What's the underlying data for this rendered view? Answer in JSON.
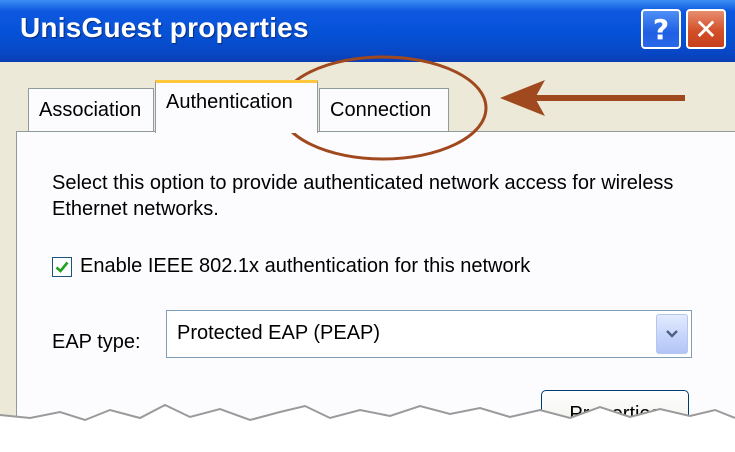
{
  "window": {
    "title": "UnisGuest properties",
    "help_label": "?",
    "close_label": "✕"
  },
  "tabs": [
    {
      "label": "Association"
    },
    {
      "label": "Authentication",
      "selected": true
    },
    {
      "label": "Connection"
    }
  ],
  "panel": {
    "description": "Select this option to provide authenticated network access for wireless Ethernet networks.",
    "enable_checkbox": {
      "label": "Enable IEEE 802.1x authentication for this network",
      "checked": true
    },
    "eap_type": {
      "label": "EAP type:",
      "value": "Protected EAP (PEAP)"
    },
    "properties_button": "Properties"
  },
  "colors": {
    "titlebar": "#0552d6",
    "tab_highlight": "#ffc73c",
    "annotation": "#a0481e",
    "checkmark": "#21a121"
  },
  "icons": [
    "help-icon",
    "close-icon",
    "checkmark-icon",
    "dropdown-arrow-icon",
    "annotation-arrow-icon"
  ]
}
